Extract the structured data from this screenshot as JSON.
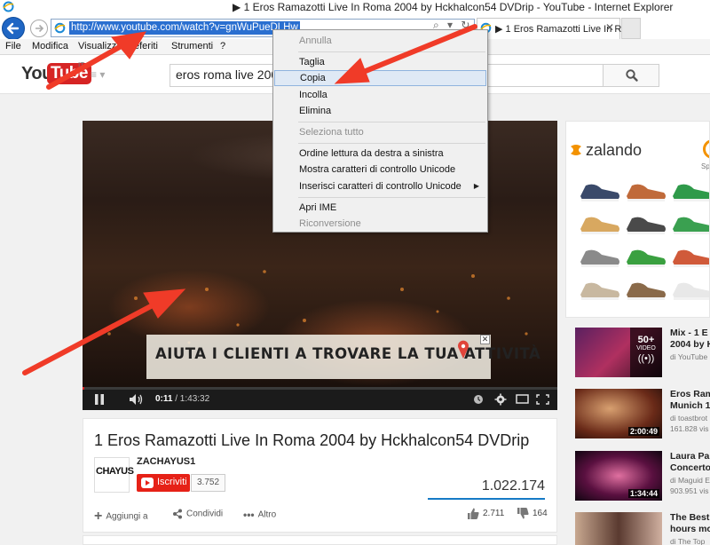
{
  "window": {
    "title": "▶ 1 Eros Ramazotti Live In Roma 2004 by Hckhalcon54 DVDrip - YouTube - Internet Explorer"
  },
  "address_bar": {
    "url": "http://www.youtube.com/watch?v=gnWuPueDLHw",
    "icons": "⌕ ▾ ↻"
  },
  "tab": {
    "label": "▶ 1 Eros Ramazotti Live In Ro...",
    "close": "✕"
  },
  "menubar": {
    "items": [
      "File",
      "Modifica",
      "Visualizza",
      "Preferiti",
      "Strumenti",
      "?"
    ]
  },
  "youtube": {
    "logo_you": "You",
    "logo_tube": "Tube",
    "logo_region": "IT",
    "guide_icon": "≡ ▾",
    "search_value": "eros roma live 2004"
  },
  "player": {
    "ad_text": "AIUTA I CLIENTI A TROVARE LA TUA ATTIVITÀ",
    "ad_close": "✕",
    "time_current": "0:11",
    "time_total": "/ 1:43:32",
    "progress_fraction": 0.002
  },
  "video": {
    "title": "1 Eros Ramazotti Live In Roma 2004 by Hckhalcon54 DVDrip",
    "channel": "ZACHAYUS1",
    "channel_avatar_text": "CHAYUS",
    "subscribe_label": "Iscriviti",
    "subscriber_count": "3.752",
    "view_count": "1.022.174",
    "actions": {
      "add": "Aggiungi a",
      "share": "Condividi",
      "more": "Altro"
    },
    "likes": "2.711",
    "dislikes": "164"
  },
  "ad_right": {
    "brand": "zalando",
    "peek_text": "Sp"
  },
  "sidebar": [
    {
      "title1": "Mix - 1 E",
      "title2": "2004 by H",
      "meta1": "di YouTube",
      "meta2": "",
      "duration": "",
      "mix_count": "50+",
      "mix_label": "VIDEO"
    },
    {
      "title1": "Eros Ram",
      "title2": "Munich 1",
      "meta1": "di toastbrot",
      "meta2": "161.828 vis",
      "duration": "2:00:49",
      "mix_count": "",
      "mix_label": ""
    },
    {
      "title1": "Laura Pa",
      "title2": "Concerto",
      "meta1": "di Maguid E",
      "meta2": "903.951 vis",
      "duration": "1:34:44",
      "mix_count": "",
      "mix_label": ""
    },
    {
      "title1": "The Best",
      "title2": "hours mo",
      "meta1": "di The Top",
      "meta2": "",
      "duration": "",
      "mix_count": "",
      "mix_label": ""
    }
  ],
  "context_menu": {
    "items": [
      {
        "label": "Annulla",
        "enabled": false
      },
      {
        "label": "Taglia",
        "enabled": true
      },
      {
        "label": "Copia",
        "enabled": true,
        "highlighted": true
      },
      {
        "label": "Incolla",
        "enabled": true
      },
      {
        "label": "Elimina",
        "enabled": true
      },
      {
        "label": "Seleziona tutto",
        "enabled": false
      },
      {
        "label": "Ordine lettura da destra a sinistra",
        "enabled": true
      },
      {
        "label": "Mostra caratteri di controllo Unicode",
        "enabled": true
      },
      {
        "label": "Inserisci caratteri di controllo Unicode",
        "enabled": true,
        "submenu": true
      },
      {
        "label": "Apri IME",
        "enabled": true
      },
      {
        "label": "Riconversione",
        "enabled": false
      }
    ],
    "submenu_arrow": "▶"
  },
  "colors": {
    "ie_blue": "#1f66c4",
    "url_selection": "#2a6fd0",
    "youtube_red": "#d62424",
    "subscribe_red": "#e62117",
    "annotation_arrow": "#f03b28",
    "menu_highlight": "#dfe9f5"
  }
}
